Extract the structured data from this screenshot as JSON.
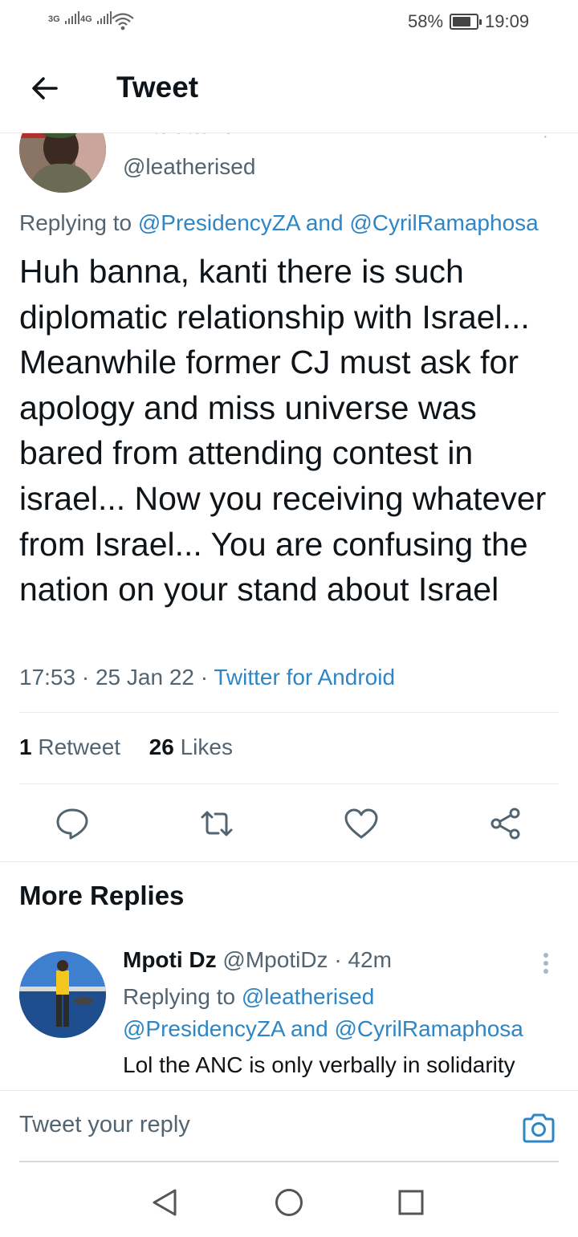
{
  "status_bar": {
    "signal_1": "3G",
    "signal_2": "4G",
    "battery": "58%",
    "time": "19:09",
    "icons": [
      "signal-icon",
      "wifi-icon",
      "battery-icon"
    ]
  },
  "header": {
    "title": "Tweet",
    "back_icon": "arrow-left-icon"
  },
  "tweet": {
    "author_name": "Braleather",
    "handle": "@leatherised",
    "replying_prefix": "Replying to ",
    "replying_user_1": "@PresidencyZA",
    "replying_and": " and ",
    "replying_user_2": "@CyrilRamaphosa",
    "text": "Huh banna, kanti there is such diplomatic relationship with Israel... Meanwhile former CJ must ask for apology and miss universe was bared from attending contest in israel... Now you receiving whatever from Israel... You are confusing the nation on your stand about Israel",
    "time": "17:53",
    "date": "25 Jan 22",
    "source": "Twitter for Android",
    "retweet_count": "1",
    "retweet_label": "Retweet",
    "like_count": "26",
    "like_label": "Likes",
    "actions": [
      "reply-icon",
      "retweet-icon",
      "like-icon",
      "share-icon"
    ]
  },
  "more_replies": {
    "heading": "More Replies",
    "reply": {
      "name": "Mpoti Dz",
      "handle": "@MpotiDz",
      "time": "42m",
      "replying_prefix": "Replying to ",
      "replying_user_1": "@leatherised",
      "replying_user_2": "@PresidencyZA",
      "replying_and": " and ",
      "replying_user_3": "@CyrilRamaphosa",
      "text": "Lol the ANC is only verbally in solidarity"
    }
  },
  "compose": {
    "placeholder": "Tweet your reply",
    "camera_icon": "camera-icon"
  },
  "nav": {
    "buttons": [
      "back-triangle-icon",
      "home-circle-icon",
      "recents-square-icon"
    ]
  },
  "colors": {
    "link": "#2f86c5",
    "secondary_text": "#536471",
    "primary_text": "#0f1419",
    "divider": "#e6ecf0"
  }
}
